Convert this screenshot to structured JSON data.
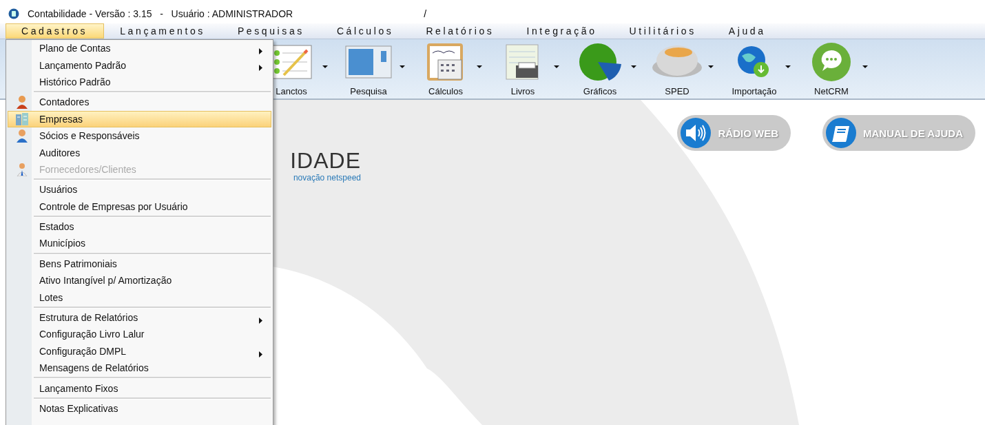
{
  "window": {
    "title": "Contabilidade - Versão : 3.15   -   Usuário : ADMINISTRADOR",
    "title_extra": "/"
  },
  "menubar": [
    {
      "label": "Cadastros",
      "selected": true
    },
    {
      "label": "Lançamentos",
      "selected": false
    },
    {
      "label": "Pesquisas",
      "selected": false
    },
    {
      "label": "Cálculos",
      "selected": false
    },
    {
      "label": "Relatórios",
      "selected": false
    },
    {
      "label": "Integração",
      "selected": false
    },
    {
      "label": "Utilitários",
      "selected": false
    },
    {
      "label": "Ajuda",
      "selected": false
    }
  ],
  "toolbar": [
    {
      "label": "Lanctos"
    },
    {
      "label": "Pesquisa"
    },
    {
      "label": "Cálculos"
    },
    {
      "label": "Livros"
    },
    {
      "label": "Gráficos"
    },
    {
      "label": "SPED"
    },
    {
      "label": "Importação"
    },
    {
      "label": "NetCRM"
    }
  ],
  "dropdown": [
    {
      "kind": "item",
      "label": "Plano de Contas",
      "submenu": true,
      "selected": false,
      "disabled": false
    },
    {
      "kind": "item",
      "label": "Lançamento Padrão",
      "submenu": true,
      "selected": false,
      "disabled": false
    },
    {
      "kind": "item",
      "label": "Histórico Padrão",
      "submenu": false,
      "selected": false,
      "disabled": false
    },
    {
      "kind": "separator"
    },
    {
      "kind": "icon-item",
      "label": "Contadores",
      "submenu": false,
      "selected": false,
      "disabled": false
    },
    {
      "kind": "icon-item",
      "label": "Empresas",
      "submenu": false,
      "selected": true,
      "disabled": false
    },
    {
      "kind": "icon-item",
      "label": "Sócios e Responsáveis",
      "submenu": false,
      "selected": false,
      "disabled": false
    },
    {
      "kind": "item",
      "label": "Auditores",
      "submenu": false,
      "selected": false,
      "disabled": false
    },
    {
      "kind": "icon-item",
      "label": "Fornecedores/Clientes",
      "submenu": false,
      "selected": false,
      "disabled": true
    },
    {
      "kind": "separator"
    },
    {
      "kind": "item",
      "label": "Usuários",
      "submenu": false,
      "selected": false,
      "disabled": false
    },
    {
      "kind": "item",
      "label": "Controle de Empresas por Usuário",
      "submenu": false,
      "selected": false,
      "disabled": false
    },
    {
      "kind": "separator"
    },
    {
      "kind": "item",
      "label": "Estados",
      "submenu": false,
      "selected": false,
      "disabled": false
    },
    {
      "kind": "item",
      "label": "Municípios",
      "submenu": false,
      "selected": false,
      "disabled": false
    },
    {
      "kind": "separator"
    },
    {
      "kind": "item",
      "label": "Bens Patrimoniais",
      "submenu": false,
      "selected": false,
      "disabled": false
    },
    {
      "kind": "item",
      "label": "Ativo Intangível p/ Amortização",
      "submenu": false,
      "selected": false,
      "disabled": false
    },
    {
      "kind": "item",
      "label": "Lotes",
      "submenu": false,
      "selected": false,
      "disabled": false
    },
    {
      "kind": "separator"
    },
    {
      "kind": "item",
      "label": "Estrutura de Relatórios",
      "submenu": true,
      "selected": false,
      "disabled": false
    },
    {
      "kind": "item",
      "label": "Configuração Livro Lalur",
      "submenu": false,
      "selected": false,
      "disabled": false
    },
    {
      "kind": "item",
      "label": "Configuração DMPL",
      "submenu": true,
      "selected": false,
      "disabled": false
    },
    {
      "kind": "item",
      "label": "Mensagens de Relatórios",
      "submenu": false,
      "selected": false,
      "disabled": false
    },
    {
      "kind": "separator"
    },
    {
      "kind": "item",
      "label": "Lançamento Fixos",
      "submenu": false,
      "selected": false,
      "disabled": false
    },
    {
      "kind": "separator"
    },
    {
      "kind": "item",
      "label": "Notas Explicativas",
      "submenu": false,
      "selected": false,
      "disabled": false
    }
  ],
  "logo": {
    "word": "IDADE",
    "tagline": "novação netspeed"
  },
  "links": [
    {
      "kind": "radio",
      "label": "RÁDIO WEB"
    },
    {
      "kind": "manual",
      "label": "MANUAL DE AJUDA"
    }
  ]
}
